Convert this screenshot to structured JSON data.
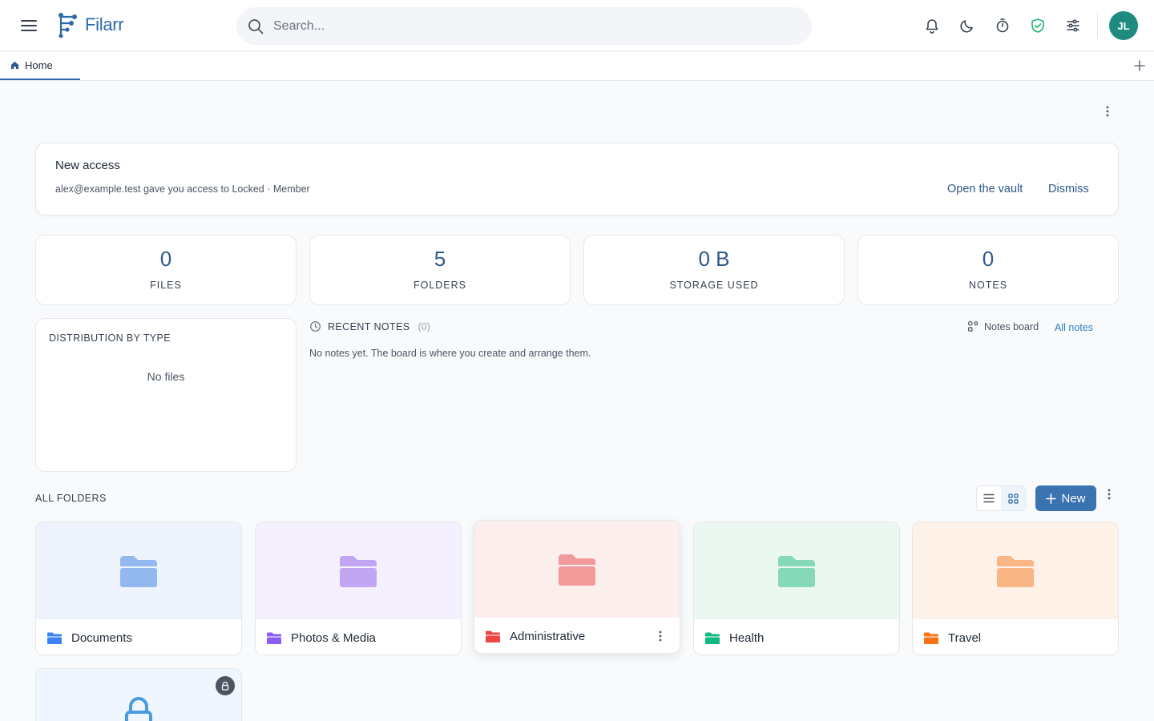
{
  "app": {
    "name": "Filarr"
  },
  "search": {
    "placeholder": "Search..."
  },
  "header": {
    "icons": [
      "bell-icon",
      "moon-icon",
      "timer-icon",
      "shield-check-icon",
      "sliders-icon"
    ],
    "user_initials": "JL",
    "accent_color": "#2f6aa8",
    "shield_color": "#22b573",
    "avatar_color": "#1f8a80"
  },
  "tabs": [
    {
      "label": "Home",
      "active": true
    }
  ],
  "notice": {
    "title": "New access",
    "description": "alex@example.test gave you access to Locked · Member",
    "primary_action": "Open the vault",
    "secondary_action": "Dismiss"
  },
  "stats": [
    {
      "value": "0",
      "label": "FILES"
    },
    {
      "value": "5",
      "label": "FOLDERS"
    },
    {
      "value": "0 B",
      "label": "STORAGE USED"
    },
    {
      "value": "0",
      "label": "NOTES"
    }
  ],
  "distribution": {
    "title": "DISTRIBUTION BY TYPE",
    "empty": "No files"
  },
  "recent_notes": {
    "title": "RECENT NOTES",
    "count": "(0)",
    "board_link": "Notes board",
    "all_link": "All notes",
    "empty": "No notes yet. The board is where you create and arrange them."
  },
  "folders_section": {
    "title": "ALL FOLDERS",
    "new_label": "New",
    "view_mode": "grid"
  },
  "folders": [
    {
      "name": "Documents",
      "color": "#3b82f6",
      "cover_color": "#eef3fd",
      "big_color": "#93b8f0"
    },
    {
      "name": "Photos & Media",
      "color": "#8b5cf6",
      "cover_color": "#f4f0fd",
      "big_color": "#c2a6f3"
    },
    {
      "name": "Administrative",
      "color": "#ef4444",
      "cover_color": "#fdeeee",
      "big_color": "#f29a9a"
    },
    {
      "name": "Health",
      "color": "#10b981",
      "cover_color": "#ebf8f2",
      "big_color": "#86d9b8"
    },
    {
      "name": "Travel",
      "color": "#f97316",
      "cover_color": "#fef1e8",
      "big_color": "#f9b583"
    }
  ],
  "locked_folder": {
    "cover_color": "#f0f6fd",
    "lock_color": "#4a9be0"
  }
}
